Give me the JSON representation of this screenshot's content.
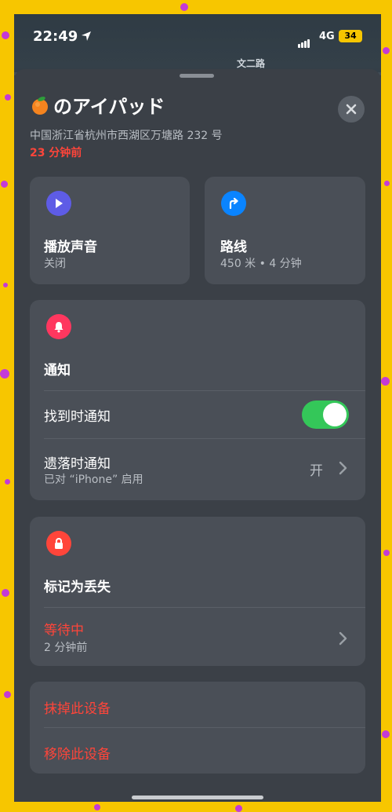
{
  "status_bar": {
    "time": "22:49",
    "network": "4G",
    "battery": "34"
  },
  "map": {
    "street_label": "文二路"
  },
  "device": {
    "name": "のアイパッド",
    "address": "中国浙江省杭州市西湖区万塘路 232 号",
    "last_seen": "23 分钟前"
  },
  "actions": {
    "play_sound": {
      "title": "播放声音",
      "subtitle": "关闭"
    },
    "directions": {
      "title": "路线",
      "subtitle": "450 米 • 4 分钟"
    }
  },
  "notifications": {
    "heading": "通知",
    "notify_when_found": {
      "label": "找到时通知",
      "enabled": true
    },
    "notify_when_left_behind": {
      "label": "遗落时通知",
      "sub": "已对 “iPhone” 启用",
      "value": "开"
    }
  },
  "lost_mode": {
    "heading": "标记为丢失",
    "status": "等待中",
    "status_sub": "2 分钟前"
  },
  "device_actions": {
    "erase": "抹掉此设备",
    "remove": "移除此设备"
  },
  "colors": {
    "play_icon": "#5e5ce6",
    "directions_icon": "#0a84ff",
    "bell_icon": "#ff375f",
    "lock_icon": "#ff453a",
    "toggle_on": "#34c759",
    "destructive": "#ff453a"
  }
}
